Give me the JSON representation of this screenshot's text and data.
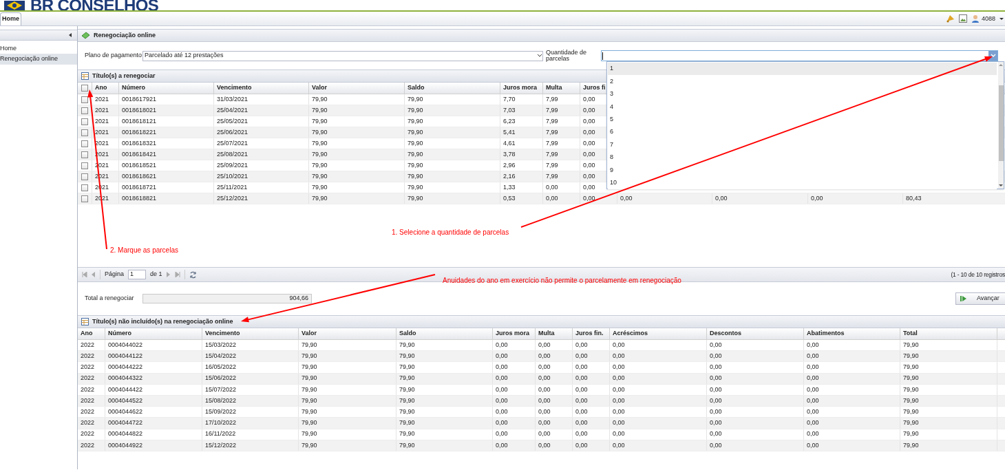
{
  "header": {
    "logo_text": "BR CONSELHOS",
    "user": "4088"
  },
  "tabs": [
    {
      "label": "Home",
      "selected": true
    }
  ],
  "sidebar": {
    "items": [
      {
        "label": "Home",
        "selected": false
      },
      {
        "label": "Renegociação online",
        "selected": true
      }
    ]
  },
  "panel": {
    "title": "Renegociação online"
  },
  "form": {
    "plan_label": "Plano de pagamento",
    "plan_value": "Parcelado até 12 prestações",
    "quantity_label": "Quantidade de parcelas",
    "quantity_options": [
      {
        "label": "1",
        "selected": true
      },
      {
        "label": "2",
        "selected": false
      },
      {
        "label": "3",
        "selected": false
      },
      {
        "label": "4",
        "selected": false
      },
      {
        "label": "5",
        "selected": false
      },
      {
        "label": "6",
        "selected": false
      },
      {
        "label": "7",
        "selected": false
      },
      {
        "label": "8",
        "selected": false
      },
      {
        "label": "9",
        "selected": false
      },
      {
        "label": "10",
        "selected": false
      }
    ]
  },
  "table1": {
    "title": "Título(s) a renegociar",
    "header_checked": false,
    "columns": [
      "Ano",
      "Número",
      "Vencimento",
      "Valor",
      "Saldo",
      "Juros mora",
      "Multa",
      "Juros fi"
    ],
    "rows": [
      {
        "checked": false,
        "cells": [
          "2021",
          "0018617921",
          "31/03/2021",
          "79,90",
          "79,90",
          "7,70",
          "7,99",
          "0,00"
        ]
      },
      {
        "checked": false,
        "cells": [
          "2021",
          "0018618021",
          "25/04/2021",
          "79,90",
          "79,90",
          "7,03",
          "7,99",
          "0,00"
        ]
      },
      {
        "checked": false,
        "cells": [
          "2021",
          "0018618121",
          "25/05/2021",
          "79,90",
          "79,90",
          "6,23",
          "7,99",
          "0,00"
        ]
      },
      {
        "checked": false,
        "cells": [
          "2021",
          "0018618221",
          "25/06/2021",
          "79,90",
          "79,90",
          "5,41",
          "7,99",
          "0,00"
        ]
      },
      {
        "checked": false,
        "cells": [
          "2021",
          "0018618321",
          "25/07/2021",
          "79,90",
          "79,90",
          "4,61",
          "7,99",
          "0,00"
        ]
      },
      {
        "checked": false,
        "cells": [
          "2021",
          "0018618421",
          "25/08/2021",
          "79,90",
          "79,90",
          "3,78",
          "7,99",
          "0,00"
        ]
      },
      {
        "checked": false,
        "cells": [
          "2021",
          "0018618521",
          "25/09/2021",
          "79,90",
          "79,90",
          "2,96",
          "7,99",
          "0,00"
        ]
      },
      {
        "checked": false,
        "cells": [
          "2021",
          "0018618621",
          "25/10/2021",
          "79,90",
          "79,90",
          "2,16",
          "7,99",
          "0,00"
        ]
      },
      {
        "checked": false,
        "cells": [
          "2021",
          "0018618721",
          "25/11/2021",
          "79,90",
          "79,90",
          "1,33",
          "0,00",
          "0,00"
        ]
      },
      {
        "checked": false,
        "cells": [
          "2021",
          "0018618821",
          "25/12/2021",
          "79,90",
          "79,90",
          "0,53",
          "0,00",
          "0,00",
          "0,00",
          "0,00",
          "0,00",
          "80,43"
        ]
      }
    ]
  },
  "pager": {
    "page_label": "Página",
    "page": "1",
    "of": "de 1",
    "summary": "(1 - 10 de 10 registros"
  },
  "total": {
    "label": "Total a renegociar",
    "value": "904,66"
  },
  "advance_button": "Avançar",
  "table2": {
    "title": "Título(s) não incluído(s) na renegociação online",
    "columns": [
      "Ano",
      "Número",
      "Vencimento",
      "Valor",
      "Saldo",
      "Juros mora",
      "Multa",
      "Juros fin.",
      "Acréscimos",
      "Descontos",
      "Abatimentos",
      "Total"
    ],
    "rows": [
      [
        "2022",
        "0004044022",
        "15/03/2022",
        "79,90",
        "79,90",
        "0,00",
        "0,00",
        "0,00",
        "0,00",
        "0,00",
        "0,00",
        "79,90"
      ],
      [
        "2022",
        "0004044122",
        "15/04/2022",
        "79,90",
        "79,90",
        "0,00",
        "0,00",
        "0,00",
        "0,00",
        "0,00",
        "0,00",
        "79,90"
      ],
      [
        "2022",
        "0004044222",
        "16/05/2022",
        "79,90",
        "79,90",
        "0,00",
        "0,00",
        "0,00",
        "0,00",
        "0,00",
        "0,00",
        "79,90"
      ],
      [
        "2022",
        "0004044322",
        "15/06/2022",
        "79,90",
        "79,90",
        "0,00",
        "0,00",
        "0,00",
        "0,00",
        "0,00",
        "0,00",
        "79,90"
      ],
      [
        "2022",
        "0004044422",
        "15/07/2022",
        "79,90",
        "79,90",
        "0,00",
        "0,00",
        "0,00",
        "0,00",
        "0,00",
        "0,00",
        "79,90"
      ],
      [
        "2022",
        "0004044522",
        "15/08/2022",
        "79,90",
        "79,90",
        "0,00",
        "0,00",
        "0,00",
        "0,00",
        "0,00",
        "0,00",
        "79,90"
      ],
      [
        "2022",
        "0004044622",
        "15/09/2022",
        "79,90",
        "79,90",
        "0,00",
        "0,00",
        "0,00",
        "0,00",
        "0,00",
        "0,00",
        "79,90"
      ],
      [
        "2022",
        "0004044722",
        "17/10/2022",
        "79,90",
        "79,90",
        "0,00",
        "0,00",
        "0,00",
        "0,00",
        "0,00",
        "0,00",
        "79,90"
      ],
      [
        "2022",
        "0004044822",
        "16/11/2022",
        "79,90",
        "79,90",
        "0,00",
        "0,00",
        "0,00",
        "0,00",
        "0,00",
        "0,00",
        "79,90"
      ],
      [
        "2022",
        "0004044922",
        "15/12/2022",
        "79,90",
        "79,90",
        "0,00",
        "0,00",
        "0,00",
        "0,00",
        "0,00",
        "0,00",
        "79,90"
      ]
    ]
  },
  "annotations": [
    {
      "text": "1. Selecione a quantidade de parcelas"
    },
    {
      "text": "2. Marque as parcelas"
    },
    {
      "text": "Anuidades do ano em exercício não permite o parcelamente em renegociação"
    }
  ]
}
